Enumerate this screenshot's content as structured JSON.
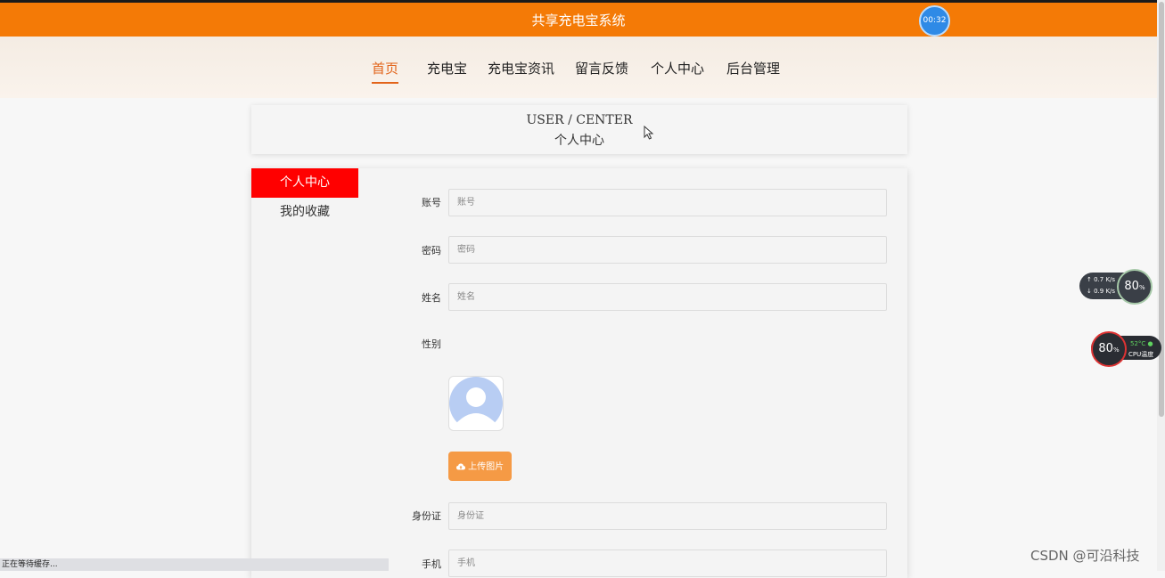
{
  "header": {
    "site_title": "共享充电宝系统",
    "timer": "00:32"
  },
  "nav": {
    "items": [
      {
        "label": "首页",
        "active": true
      },
      {
        "label": "充电宝"
      },
      {
        "label": "充电宝资讯"
      },
      {
        "label": "留言反馈"
      },
      {
        "label": "个人中心"
      },
      {
        "label": "后台管理"
      }
    ]
  },
  "banner": {
    "title_en": "USER / CENTER",
    "title_zh": "个人中心"
  },
  "sidebar": {
    "items": [
      {
        "label": "个人中心",
        "active": true
      },
      {
        "label": "我的收藏"
      }
    ]
  },
  "form": {
    "account": {
      "label": "账号",
      "placeholder": "账号"
    },
    "password": {
      "label": "密码",
      "placeholder": "密码"
    },
    "name": {
      "label": "姓名",
      "placeholder": "姓名"
    },
    "gender": {
      "label": "性别"
    },
    "upload_label": "上传图片",
    "id_card": {
      "label": "身份证",
      "placeholder": "身份证"
    },
    "phone": {
      "label": "手机",
      "placeholder": "手机"
    }
  },
  "widgets": {
    "net_up": "0.7",
    "net_down": "0.9",
    "net_unit": "K/s",
    "net_percent": "80",
    "cpu_percent": "80",
    "percent_sign": "%",
    "cpu_temp": "52°C",
    "cpu_label": "CPU温度"
  },
  "status_bar": "正在等待缓存...",
  "watermark": "CSDN @可沿科技",
  "colors": {
    "topbar": "#f47a06",
    "nav_active": "#e2641a",
    "sidebar_active": "#ff0000",
    "upload_button": "#f59a45"
  }
}
